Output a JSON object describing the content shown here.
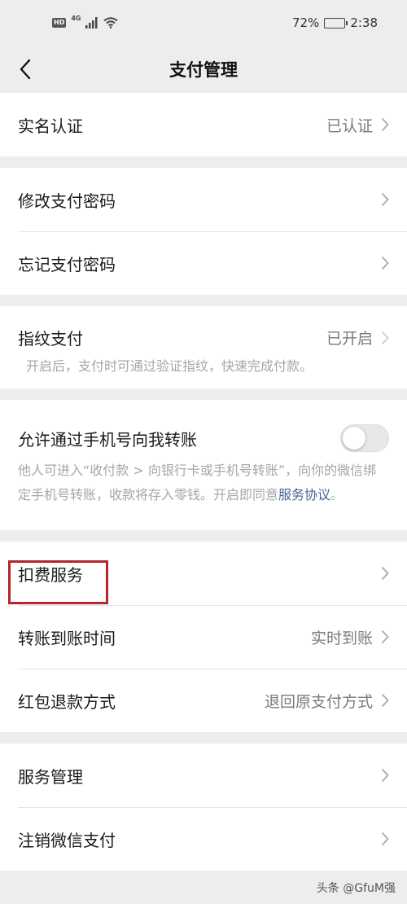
{
  "status_bar": {
    "hd": "HD",
    "network": "4G",
    "battery_percent": "72%",
    "battery_level": 0.72,
    "time": "2:38"
  },
  "nav": {
    "title": "支付管理"
  },
  "groups": {
    "realname": {
      "label": "实名认证",
      "value": "已认证"
    },
    "change_password": {
      "label": "修改支付密码"
    },
    "forgot_password": {
      "label": "忘记支付密码"
    },
    "fingerprint": {
      "label": "指纹支付",
      "value": "已开启",
      "description": "开启后，支付时可通过验证指纹，快速完成付款。"
    },
    "phone_transfer": {
      "label": "允许通过手机号向我转账",
      "enabled": false,
      "description_prefix": "他人可进入“收付款 > 向银行卡或手机号转账”，向你的微信绑定手机号转账，收款将存入零钱。开启即同意",
      "description_link": "服务协议",
      "description_suffix": "。"
    },
    "deduction": {
      "label": "扣费服务"
    },
    "transfer_time": {
      "label": "转账到账时间",
      "value": "实时到账"
    },
    "redpacket_refund": {
      "label": "红包退款方式",
      "value": "退回原支付方式"
    },
    "service_manage": {
      "label": "服务管理"
    },
    "cancel_pay": {
      "label": "注销微信支付"
    }
  },
  "watermark": "头条 @GfuM强",
  "colors": {
    "highlight": "#b3262b",
    "link": "#4a6494",
    "background": "#ededed"
  }
}
